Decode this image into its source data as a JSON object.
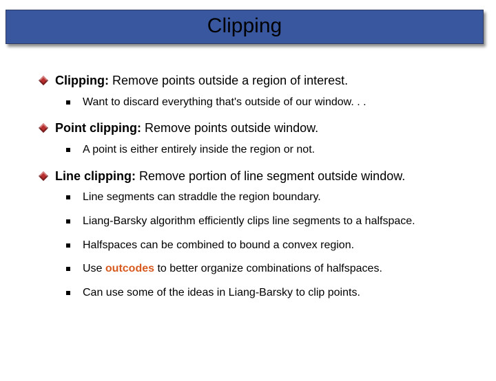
{
  "title": "Clipping",
  "sections": [
    {
      "head_bold": "Clipping:",
      "head_rest": " Remove points outside a region of interest.",
      "subs": [
        {
          "text": "Want to discard everything that's outside of our window. . ."
        }
      ]
    },
    {
      "head_bold": "Point clipping:",
      "head_rest": " Remove points outside window.",
      "subs": [
        {
          "text": "A point is either entirely inside the region or not."
        }
      ]
    },
    {
      "head_bold": "Line clipping:",
      "head_rest": " Remove portion of line segment outside window.",
      "subs": [
        {
          "text": "Line segments can straddle the region boundary."
        },
        {
          "text": "Liang-Barsky algorithm efficiently clips line segments to a halfspace."
        },
        {
          "text": "Halfspaces can be combined to bound a convex region."
        },
        {
          "pre": "Use ",
          "hl": "outcodes",
          "post": " to better organize combinations of halfspaces."
        },
        {
          "text": "Can use some of the ideas in Liang-Barsky to clip points."
        }
      ]
    }
  ]
}
